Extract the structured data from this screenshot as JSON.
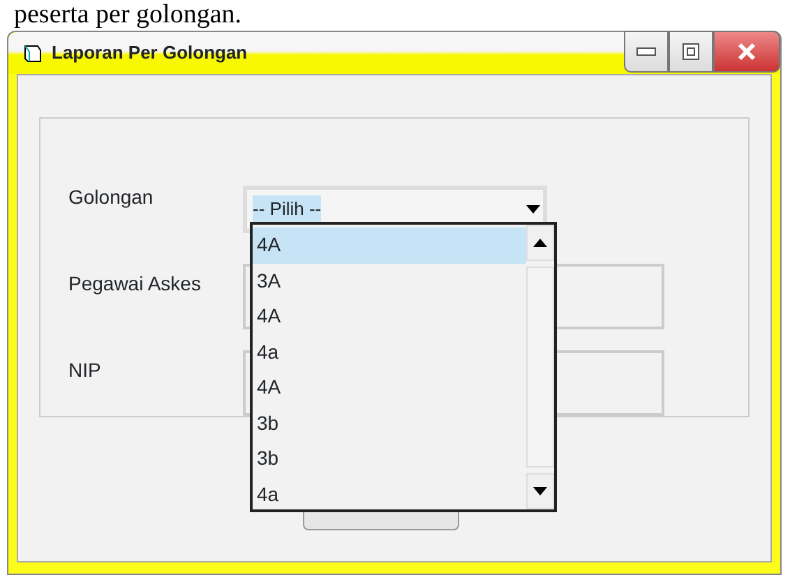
{
  "document_text": "peserta per golongan.",
  "window": {
    "title": "Laporan Per Golongan"
  },
  "fields": [
    {
      "label": "Golongan",
      "kind": "combo",
      "value": "-- Pilih --"
    },
    {
      "label": "Pegawai Askes",
      "kind": "text"
    },
    {
      "label": "NIP",
      "kind": "text"
    }
  ],
  "dropdown": {
    "items": [
      {
        "label": "4A",
        "selected": true
      },
      {
        "label": "3A",
        "selected": false
      },
      {
        "label": "4A",
        "selected": false
      },
      {
        "label": "4a",
        "selected": false
      },
      {
        "label": "4A",
        "selected": false
      },
      {
        "label": "3b",
        "selected": false
      },
      {
        "label": "3b",
        "selected": false
      },
      {
        "label": "4a",
        "selected": false
      }
    ]
  }
}
